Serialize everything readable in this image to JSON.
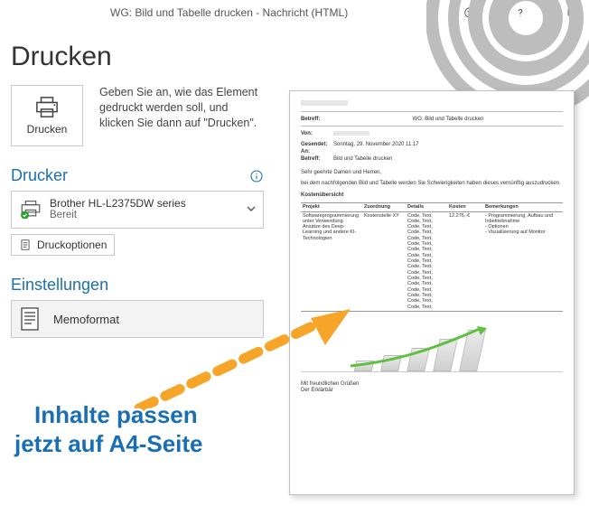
{
  "window": {
    "title": "WG: Bild und Tabelle drucken  -  Nachricht (HTML)"
  },
  "page": {
    "heading": "Drucken",
    "print_button_label": "Drucken",
    "description": "Geben Sie an, wie das Element gedruckt werden soll, und klicken Sie dann auf \"Drucken\"."
  },
  "printer_section": {
    "heading": "Drucker",
    "name": "Brother HL-L2375DW series",
    "status": "Bereit",
    "options_label": "Druckoptionen"
  },
  "settings_section": {
    "heading": "Einstellungen",
    "memo_label": "Memoformat"
  },
  "annotation": {
    "line1": "Inhalte passen",
    "line2": "jetzt auf A4-Seite"
  },
  "preview": {
    "subject_label": "Betreff:",
    "subject": "WG: Bild und Tabelle drucken",
    "from_label": "Von:",
    "sent_label": "Gesendet:",
    "sent": "Sonntag, 29. November 2020 11:17",
    "to_label": "An:",
    "subject2_label": "Betreff:",
    "subject2": "Bild und Tabelle drucken",
    "greeting": "Sehr geehrte Damen und Herren,",
    "body_line": "bei dem nachfolgenden Bild und Tabelle werden Sie Schwierigkeiten haben dieses vernünftig auszudrucken.",
    "table_title": "Kostenübersicht",
    "columns": {
      "proj": "Projekt",
      "ord": "Zuordnung",
      "det": "Details",
      "cost": "Kosten",
      "rem": "Bemerkungen"
    },
    "row": {
      "proj": "Softwareprogrammierung unter Verwendung Ansätze des Deep-Learning und andere KI-Technologien",
      "ord": "Kostenstelle XY",
      "det_line": "Code, Text,",
      "cost": "12.276,-€",
      "rem": "- Programmierung, Aufbau und Inbetriebnahme\n- Optionen\n- Visualisierung auf Monitor"
    },
    "closing1": "Mit freundlichen Grüßen",
    "closing2": "Der Erklärbär"
  }
}
